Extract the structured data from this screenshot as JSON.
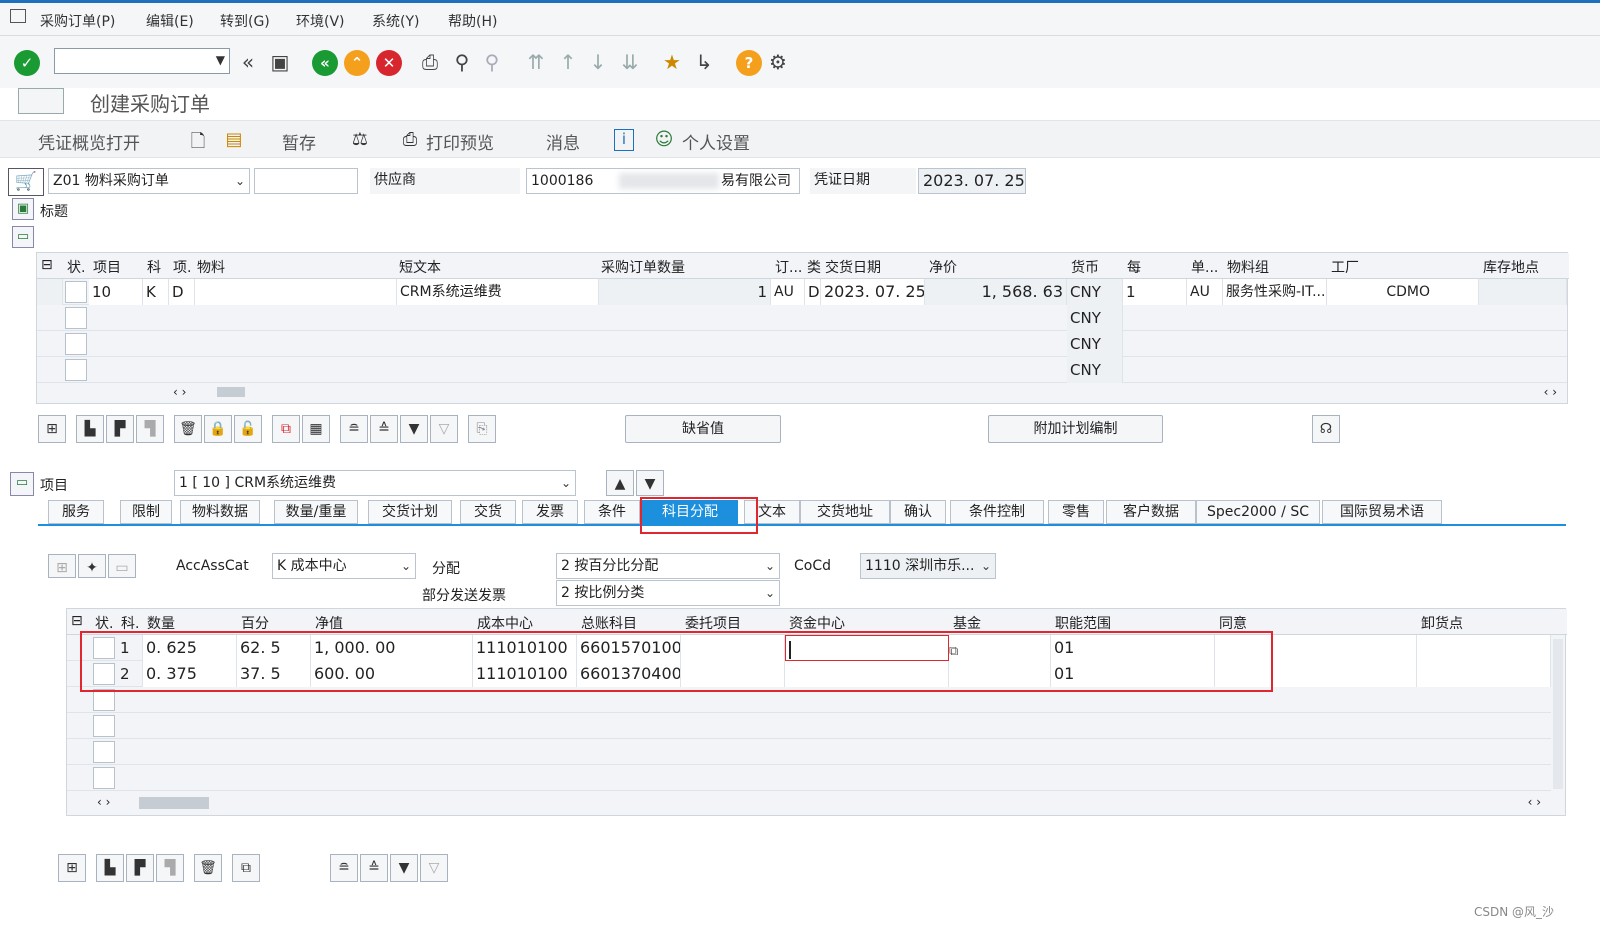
{
  "menubar": {
    "items": [
      "采购订单(P)",
      "编辑(E)",
      "转到(G)",
      "环境(V)",
      "系统(Y)",
      "帮助(H)"
    ]
  },
  "toolbar": {
    "icons": [
      "check-icon",
      "back-icon",
      "save-icon",
      "nav-back-icon",
      "nav-up-icon",
      "cancel-icon",
      "print-icon",
      "find-icon",
      "find-next-icon",
      "first-page-icon",
      "prev-page-icon",
      "next-page-icon",
      "last-page-icon",
      "new-session-icon",
      "shortcut-icon",
      "help-icon",
      "settings-icon"
    ],
    "colors": {
      "green": "#1a9a33",
      "orange": "#f4a01c",
      "red": "#d7262d",
      "brand": "#1f6fbf"
    }
  },
  "title": "创建采购订单",
  "apptoolbar": {
    "doc_overview": "凭证概览打开",
    "hold": "暂存",
    "print_preview": "打印预览",
    "messages": "消息",
    "personal_settings": "个人设置"
  },
  "header": {
    "order_type": "Z01 物料采购订单",
    "order_number": "",
    "vendor_label": "供应商",
    "vendor_value": "1000186",
    "vendor_name_suffix": "易有限公司",
    "doc_date_label": "凭证日期",
    "doc_date_value": "2023. 07. 25",
    "header_section_label": "标题"
  },
  "item_table": {
    "columns": [
      "状.",
      "项目",
      "科",
      "项.",
      "物料",
      "短文本",
      "采购订单数量",
      "订...",
      "类",
      "交货日期",
      "净价",
      "货币",
      "每",
      "单...",
      "物料组",
      "工厂",
      "库存地点"
    ],
    "rows": [
      {
        "item": "10",
        "acct": "K",
        "itemcat": "D",
        "material": "",
        "short_text": "CRM系统运维费",
        "qty": "1",
        "uom": "AU",
        "cat": "D",
        "delivery": "2023. 07. 25",
        "net_price": "1, 568. 63",
        "currency": "CNY",
        "per": "1",
        "unit": "AU",
        "mat_group": "服务性采购-IT...",
        "plant": "CDMO"
      },
      {
        "currency": "CNY"
      },
      {
        "currency": "CNY"
      },
      {
        "currency": "CNY"
      }
    ]
  },
  "item_buttons": {
    "default_values": "缺省值",
    "additional_planning": "附加计划编制"
  },
  "item_selector": {
    "label": "项目",
    "value": "1 [ 10 ] CRM系统运维费"
  },
  "tabs": [
    "服务",
    "限制",
    "物料数据",
    "数量/重量",
    "交货计划",
    "交货",
    "发票",
    "条件",
    "科目分配",
    "文本",
    "交货地址",
    "确认",
    "条件控制",
    "零售",
    "客户数据",
    "Spec2000 / SC",
    "国际贸易术语"
  ],
  "active_tab": "科目分配",
  "acct_assignment": {
    "acc_ass_cat_label": "AccAssCat",
    "acc_ass_cat_value": "K 成本中心",
    "distribution_label": "分配",
    "distribution_value": "2 按百分比分配",
    "partial_invoice_label": "部分发送发票",
    "partial_invoice_value": "2 按比例分类",
    "cocd_label": "CoCd",
    "cocd_value": "1110 深圳市乐..."
  },
  "acct_table": {
    "columns": [
      "状.",
      "科.",
      "数量",
      "百分",
      "净值",
      "成本中心",
      "总账科目",
      "委托项目",
      "资金中心",
      "基金",
      "职能范围",
      "同意",
      "卸货点"
    ],
    "rows": [
      {
        "no": "1",
        "qty": "0. 625",
        "pct": "62. 5",
        "net": "1, 000. 00",
        "cost_center": "111010100",
        "gl": "6601570100",
        "func_area": "01"
      },
      {
        "no": "2",
        "qty": "0. 375",
        "pct": "37. 5",
        "net": "600. 00",
        "cost_center": "111010100",
        "gl": "6601370400",
        "func_area": "01"
      },
      {},
      {},
      {}
    ]
  },
  "watermark": "CSDN @风_沙"
}
